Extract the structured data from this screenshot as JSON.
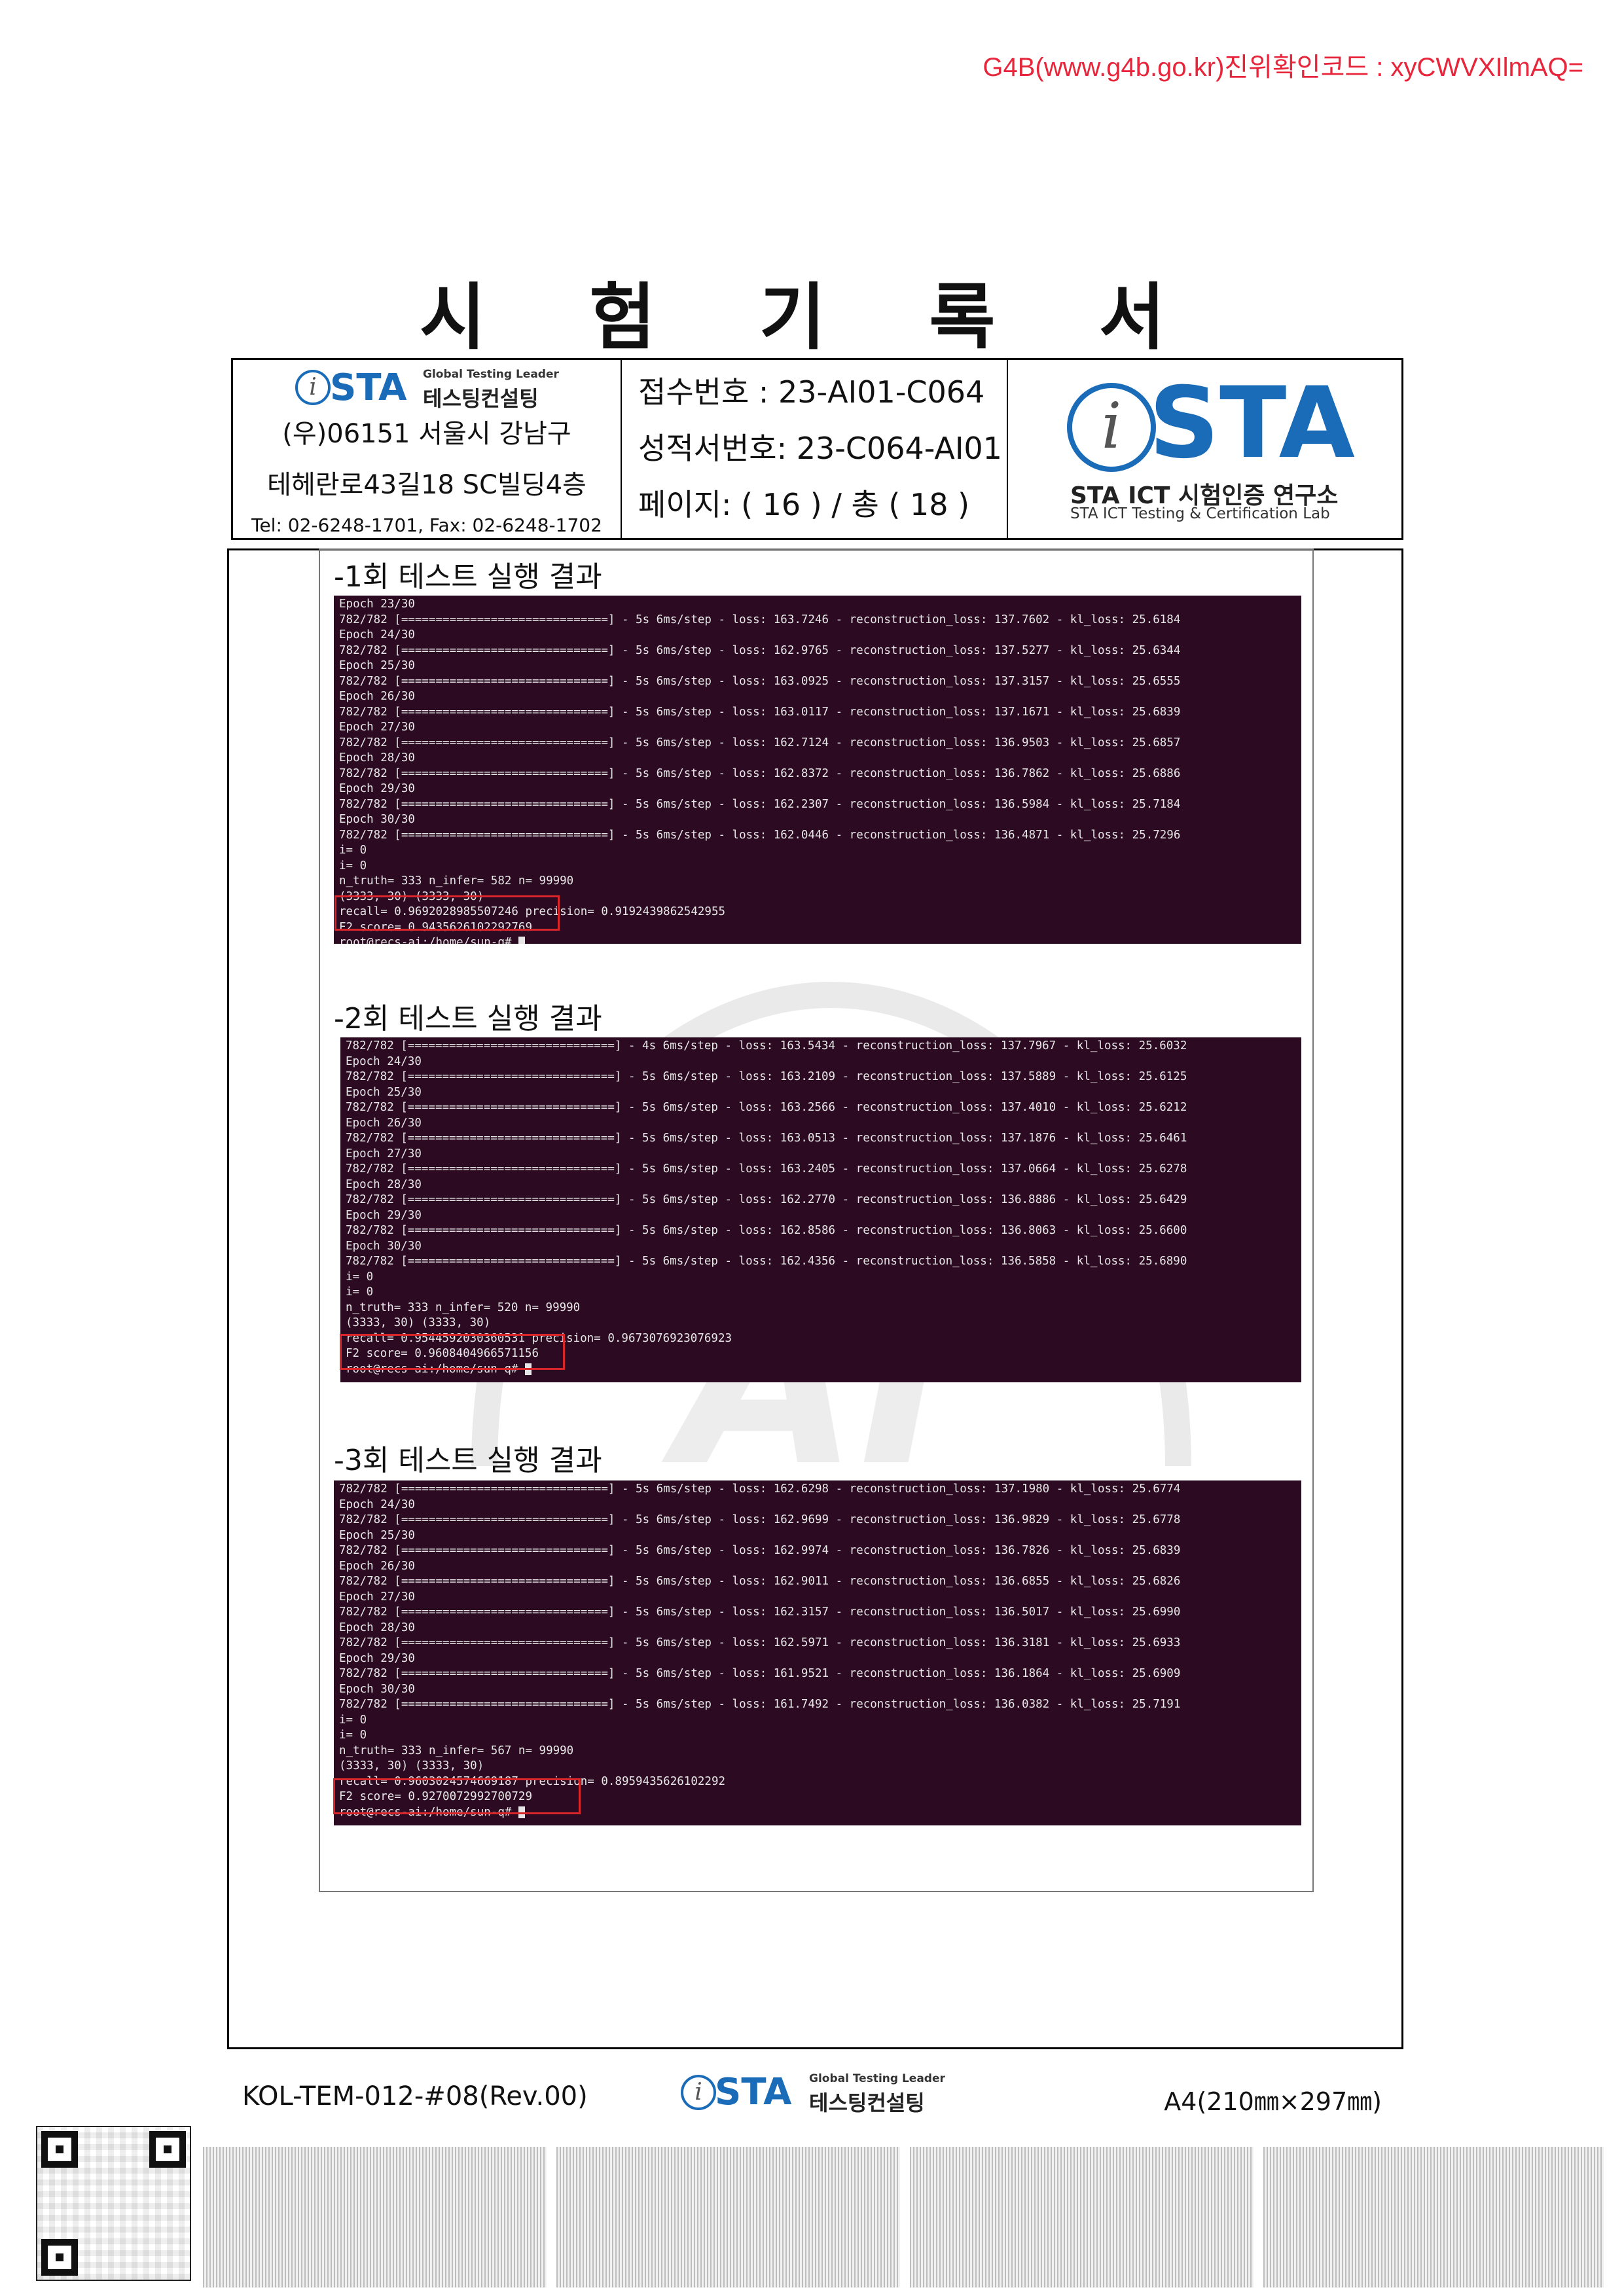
{
  "verification": "G4B(www.g4b.go.kr)진위확인코드 : xyCWVXIlmAQ=",
  "title": "시 험 기 록 서",
  "header": {
    "company_tagline": "Global Testing Leader",
    "company_name": "테스팅컨설팅",
    "logo_word": "STA",
    "address_line1": "(우)06151  서울시  강남구",
    "address_line2": "테헤란로43길18 SC빌딩4층",
    "contact": "Tel: 02-6248-1701, Fax: 02-6248-1702",
    "receipt_no": "접수번호  : 23-AI01-C064",
    "report_no": "성적서번호: 23-C064-AI01",
    "page_info": "페이지: ( 16 ) /  총  ( 18 )",
    "lab_name": "STA ICT 시험인증 연구소",
    "lab_name_en": "STA ICT Testing & Certification Lab"
  },
  "runs": [
    {
      "label": "-1회  테스트  실행  결과",
      "lines": [
        "Epoch 23/30",
        "782/782 [==============================] - 5s 6ms/step - loss: 163.7246 - reconstruction_loss: 137.7602 - kl_loss: 25.6184",
        "Epoch 24/30",
        "782/782 [==============================] - 5s 6ms/step - loss: 162.9765 - reconstruction_loss: 137.5277 - kl_loss: 25.6344",
        "Epoch 25/30",
        "782/782 [==============================] - 5s 6ms/step - loss: 163.0925 - reconstruction_loss: 137.3157 - kl_loss: 25.6555",
        "Epoch 26/30",
        "782/782 [==============================] - 5s 6ms/step - loss: 163.0117 - reconstruction_loss: 137.1671 - kl_loss: 25.6839",
        "Epoch 27/30",
        "782/782 [==============================] - 5s 6ms/step - loss: 162.7124 - reconstruction_loss: 136.9503 - kl_loss: 25.6857",
        "Epoch 28/30",
        "782/782 [==============================] - 5s 6ms/step - loss: 162.8372 - reconstruction_loss: 136.7862 - kl_loss: 25.6886",
        "Epoch 29/30",
        "782/782 [==============================] - 5s 6ms/step - loss: 162.2307 - reconstruction_loss: 136.5984 - kl_loss: 25.7184",
        "Epoch 30/30",
        "782/782 [==============================] - 5s 6ms/step - loss: 162.0446 - reconstruction_loss: 136.4871 - kl_loss: 25.7296",
        "i= 0",
        "i= 0",
        "n_truth= 333 n_infer= 582 n= 99990",
        "(3333, 30) (3333, 30)",
        "recall= 0.9692028985507246 precision= 0.9192439862542955",
        "F2 score= 0.9435626102292769",
        "root@recs-ai:/home/sun-q# "
      ]
    },
    {
      "label": "-2회  테스트  실행  결과",
      "lines": [
        "782/782 [==============================] - 4s 6ms/step - loss: 163.5434 - reconstruction_loss: 137.7967 - kl_loss: 25.6032",
        "Epoch 24/30",
        "782/782 [==============================] - 5s 6ms/step - loss: 163.2109 - reconstruction_loss: 137.5889 - kl_loss: 25.6125",
        "Epoch 25/30",
        "782/782 [==============================] - 5s 6ms/step - loss: 163.2566 - reconstruction_loss: 137.4010 - kl_loss: 25.6212",
        "Epoch 26/30",
        "782/782 [==============================] - 5s 6ms/step - loss: 163.0513 - reconstruction_loss: 137.1876 - kl_loss: 25.6461",
        "Epoch 27/30",
        "782/782 [==============================] - 5s 6ms/step - loss: 163.2405 - reconstruction_loss: 137.0664 - kl_loss: 25.6278",
        "Epoch 28/30",
        "782/782 [==============================] - 5s 6ms/step - loss: 162.2770 - reconstruction_loss: 136.8886 - kl_loss: 25.6429",
        "Epoch 29/30",
        "782/782 [==============================] - 5s 6ms/step - loss: 162.8586 - reconstruction_loss: 136.8063 - kl_loss: 25.6600",
        "Epoch 30/30",
        "782/782 [==============================] - 5s 6ms/step - loss: 162.4356 - reconstruction_loss: 136.5858 - kl_loss: 25.6890",
        "i= 0",
        "i= 0",
        "n_truth= 333 n_infer= 520 n= 99990",
        "(3333, 30) (3333, 30)",
        "recall= 0.9544592030360531 precision= 0.9673076923076923",
        "F2 score= 0.9608404966571156",
        "root@recs-ai:/home/sun-q# "
      ]
    },
    {
      "label": "-3회  테스트  실행  결과",
      "lines": [
        "782/782 [==============================] - 5s 6ms/step - loss: 162.6298 - reconstruction_loss: 137.1980 - kl_loss: 25.6774",
        "Epoch 24/30",
        "782/782 [==============================] - 5s 6ms/step - loss: 162.9699 - reconstruction_loss: 136.9829 - kl_loss: 25.6778",
        "Epoch 25/30",
        "782/782 [==============================] - 5s 6ms/step - loss: 162.9974 - reconstruction_loss: 136.7826 - kl_loss: 25.6839",
        "Epoch 26/30",
        "782/782 [==============================] - 5s 6ms/step - loss: 162.9011 - reconstruction_loss: 136.6855 - kl_loss: 25.6826",
        "Epoch 27/30",
        "782/782 [==============================] - 5s 6ms/step - loss: 162.3157 - reconstruction_loss: 136.5017 - kl_loss: 25.6990",
        "Epoch 28/30",
        "782/782 [==============================] - 5s 6ms/step - loss: 162.5971 - reconstruction_loss: 136.3181 - kl_loss: 25.6933",
        "Epoch 29/30",
        "782/782 [==============================] - 5s 6ms/step - loss: 161.9521 - reconstruction_loss: 136.1864 - kl_loss: 25.6909",
        "Epoch 30/30",
        "782/782 [==============================] - 5s 6ms/step - loss: 161.7492 - reconstruction_loss: 136.0382 - kl_loss: 25.7191",
        "i= 0",
        "i= 0",
        "n_truth= 333 n_infer= 567 n= 99990",
        "(3333, 30) (3333, 30)",
        "recall= 0.9603024574669187 precision= 0.8959435626102292",
        "F2 score= 0.9270072992700729",
        "root@recs-ai:/home/sun-q# "
      ]
    }
  ],
  "footer": {
    "form_code": "KOL-TEM-012-#08(Rev.00)",
    "paper_size": "A4(210㎜×297㎜)",
    "tagline": "Global Testing Leader",
    "company_name": "테스팅컨설팅",
    "logo_word": "STA"
  },
  "colors": {
    "verification_text": "#e8263b",
    "terminal_bg": "#2c0a22",
    "highlight_box": "#d8262b",
    "brand_blue": "#1a6bb8"
  }
}
